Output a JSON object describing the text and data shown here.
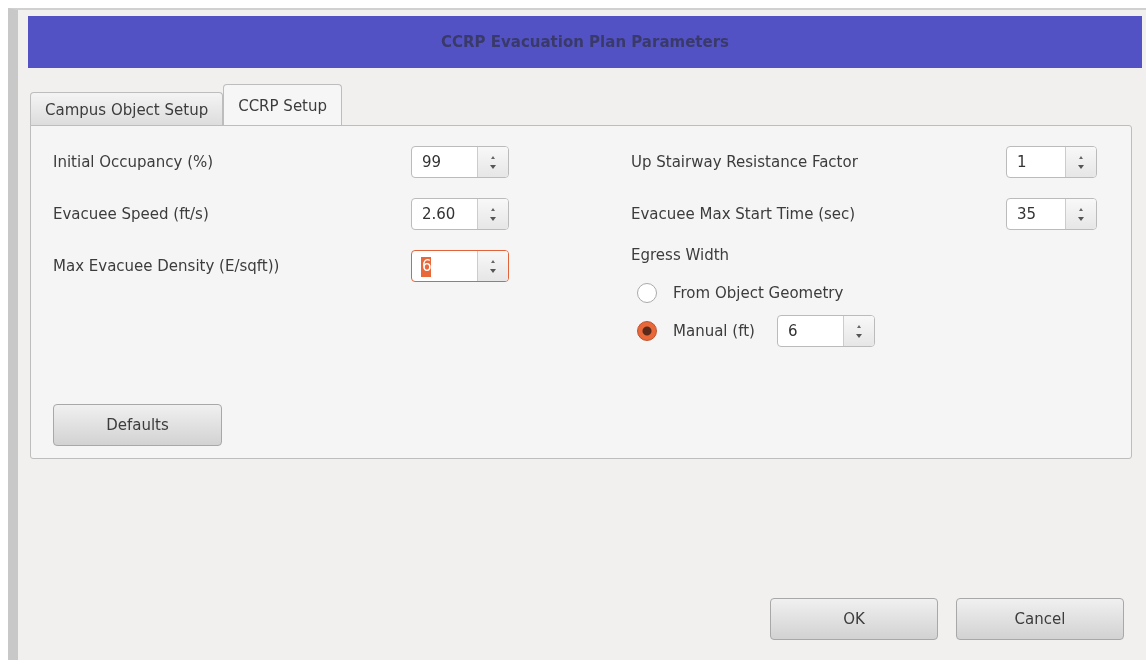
{
  "window": {
    "title": "CCRP Evacuation Plan Parameters"
  },
  "tabs": [
    {
      "label": "Campus Object Setup",
      "selected": false
    },
    {
      "label": "CCRP Setup",
      "selected": true
    }
  ],
  "left_fields": [
    {
      "label": "Initial Occupancy (%)",
      "value": "99",
      "focused": false
    },
    {
      "label": "Evacuee Speed (ft/s)",
      "value": "2.60",
      "focused": false
    },
    {
      "label": "Max Evacuee Density (E/sqft))",
      "value": "6",
      "focused": true
    }
  ],
  "right_fields": [
    {
      "label": "Up Stairway Resistance Factor",
      "value": "1",
      "focused": false
    },
    {
      "label": "Evacuee Max Start Time (sec)",
      "value": "35",
      "focused": false
    }
  ],
  "egress": {
    "label": "Egress Width",
    "options": [
      {
        "label": "From Object Geometry",
        "selected": false
      },
      {
        "label": "Manual (ft)",
        "selected": true,
        "value": "6"
      }
    ]
  },
  "defaults_button": "Defaults",
  "buttons": [
    "OK",
    "Cancel"
  ]
}
